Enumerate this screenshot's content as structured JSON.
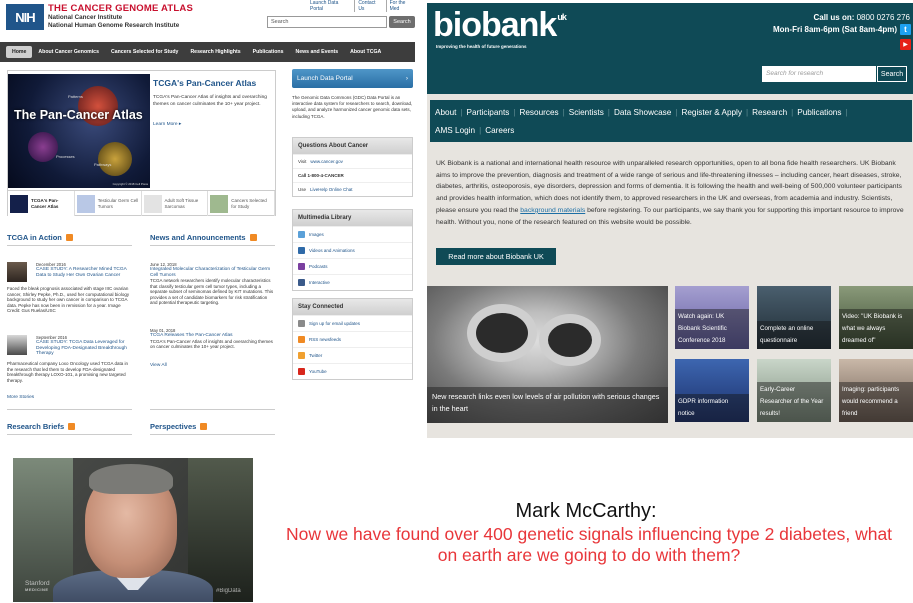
{
  "tcga": {
    "logo": "NIH",
    "title": "THE CANCER GENOME ATLAS",
    "subtitle_1": "National Cancer Institute",
    "subtitle_2": "National Human Genome Research Institute",
    "top_links": [
      "Launch Data Portal",
      "Contact Us",
      "For the Med"
    ],
    "search_placeholder": "Search",
    "search_button": "Search",
    "nav": [
      "Home",
      "About Cancer Genomics",
      "Cancers Selected for Study",
      "Research Highlights",
      "Publications",
      "News and Events",
      "About TCGA"
    ],
    "hero": {
      "image_text": "The Pan-Cancer Atlas",
      "image_labels": [
        "Patterns",
        "Processes",
        "Pathways"
      ],
      "copyright": "Copyright © 2018 Cell Press",
      "title": "TCGA's Pan-Cancer Atlas",
      "description": "TCGA's Pan-Cancer Atlas of insights and overarching themes on cancer culminates the 10+ year project.",
      "learn_more": "Learn More"
    },
    "thumbs": [
      "TCGA's Pan-Cancer Atlas",
      "Testicular Germ Cell Tumors",
      "Adult Soft Tissue Sarcomas",
      "Cancers Selected for Study"
    ],
    "launch_button": "Launch Data Portal",
    "gdc_text": "The Genomic Data Commons (GDC) Data Portal is an interactive data system for researchers to search, download, upload, and analyze harmonized cancer genomic data sets, including TCGA.",
    "questions": {
      "header": "Questions About Cancer",
      "visit_prefix": "Visit ",
      "visit_link": "www.cancer.gov",
      "call": "Call 1-800-4-CANCER",
      "use_prefix": "Use ",
      "use_link": "LiveHelp Online Chat"
    },
    "multimedia": {
      "header": "Multimedia Library",
      "items": [
        "Images",
        "Videos and Animations",
        "Podcasts",
        "Interactive"
      ]
    },
    "stay": {
      "header": "Stay Connected",
      "items": [
        "Sign up for email updates",
        "RSS newsfeeds",
        "Twitter",
        "YouTube"
      ]
    },
    "in_action": {
      "header": "TCGA in Action",
      "items": [
        {
          "date": "December 2016",
          "title": "CASE STUDY: A Researcher Mined TCGA Data to Study Her Own Ovarian Cancer",
          "text": "Faced the bleak prognosis associated with stage IIIC ovarian cancer, Shirley Pepke, Ph.D., used her computational biology background to study her own cancer in comparison to TCGA data. Pepke has now been in remission for a year. Image Credit: Gus Ruelas/USC"
        },
        {
          "date": "September 2016",
          "title": "CASE STUDY: TCGA Data Leveraged for Developing FDA-Designated Breakthrough Therapy",
          "text": "Pharmaceutical company Loxo Oncology used TCGA data in the research that led them to develop FDA-designated breakthrough therapy LOXO-101, a promising new targeted therapy."
        }
      ],
      "more": "More Stories"
    },
    "news": {
      "header": "News and Announcements",
      "items": [
        {
          "date": "June 12, 2018",
          "title": "Integrated Molecular Characterization of Testicular Germ Cell Tumors",
          "text": "TCGA network researchers identify molecular characteristics that classify testicular germ cell tumor types, including a separate subset of seminomas defined by KIT mutations. This provides a set of candidate biomarkers for risk stratification and potential therapeutic targeting."
        },
        {
          "date": "May 01, 2018",
          "title": "TCGA Releases The Pan-Cancer Atlas",
          "text": "TCGA's Pan-Cancer Atlas of insights and overarching themes on cancer culminates the 10+ year project."
        }
      ],
      "view_all": "View All"
    },
    "research_briefs": "Research Briefs",
    "perspectives": "Perspectives"
  },
  "biobank": {
    "logo": "biobank",
    "logo_sup": "uk",
    "tagline": "Improving the health of future generations",
    "call_label": "Call us on:",
    "call_number": "0800 0276 276",
    "hours": "Mon-Fri 8am-6pm (Sat 8am-4pm)",
    "search_placeholder": "Search for research",
    "search_button": "Search",
    "nav": [
      "About",
      "Participants",
      "Resources",
      "Scientists",
      "Data Showcase",
      "Register & Apply",
      "Research",
      "Publications"
    ],
    "nav_row2": [
      "AMS Login",
      "Careers"
    ],
    "intro_pre": "UK Biobank is a national and international health resource with unparalleled research opportunities, open to all bona fide health researchers. UK Biobank aims to improve the prevention, diagnosis and treatment of a wide range of serious and life-threatening illnesses – including cancer, heart diseases, stroke, diabetes, arthritis, osteoporosis, eye disorders, depression and forms of dementia. It is following the health and well-being of 500,000 volunteer participants and provides health information, which does not identify them, to approved researchers in the UK and overseas, from academia and industry. Scientists, please ensure you read the ",
    "intro_link": "background materials",
    "intro_post": " before registering. To our participants, we say thank you for supporting this important resource to improve health. Without you, none of the research featured on this website would be possible.",
    "read_more": "Read more about Biobank UK",
    "big_caption": "New research links even low levels of air pollution with serious changes in the heart",
    "tiles": [
      "Watch again: UK Biobank Scientific Conference 2018",
      "Complete an online questionnaire",
      "Video: \"UK Biobank is what we always dreamed of\"",
      "GDPR information notice",
      "Early-Career Researcher of the Year results!",
      "Imaging: participants would recommend a friend"
    ]
  },
  "video": {
    "logo": "Stanford",
    "logo_sub": "MEDICINE",
    "hashtag": "#BigData"
  },
  "quote": {
    "speaker": "Mark McCarthy:",
    "text": "Now we have found over 400 genetic signals influencing type 2 diabetes, what on earth are we going to do with them?"
  },
  "colors": {
    "tcga_red": "#c8102e",
    "tcga_blue": "#20558a",
    "biobank_teal": "#0f4a56",
    "quote_red": "#e8363a"
  }
}
